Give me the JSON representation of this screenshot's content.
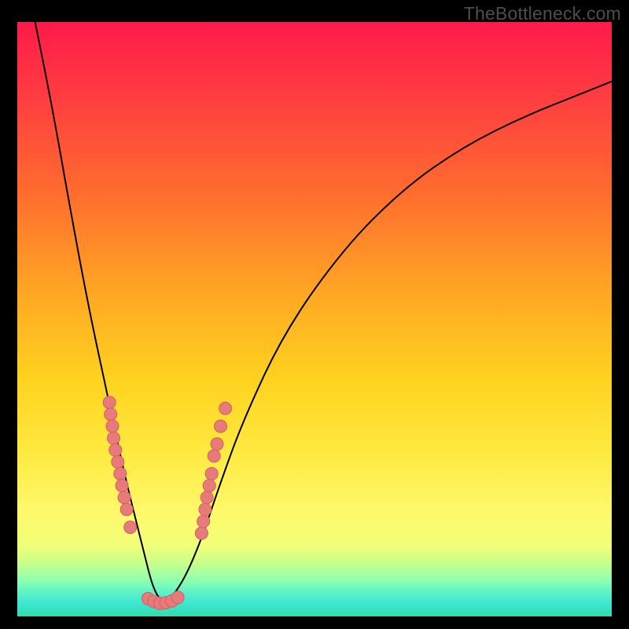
{
  "attribution": "TheBottleneck.com",
  "chart_data": {
    "type": "line",
    "title": "",
    "xlabel": "",
    "ylabel": "",
    "xlim": [
      0,
      100
    ],
    "ylim": [
      0,
      100
    ],
    "curve": {
      "description": "V-shaped bottleneck curve; minimum bottleneck near x≈24",
      "x": [
        3,
        6,
        9,
        12,
        15,
        18,
        21,
        23,
        25,
        28,
        31,
        34,
        38,
        45,
        55,
        65,
        75,
        85,
        95,
        100
      ],
      "y": [
        100,
        85,
        68,
        52,
        38,
        24,
        12,
        4,
        2,
        6,
        13,
        22,
        33,
        48,
        62,
        72,
        79,
        84,
        88,
        90
      ]
    },
    "series": [
      {
        "name": "left-cluster-dots",
        "color": "#e77a7a",
        "x": [
          15.5,
          15.7,
          16.0,
          16.2,
          16.5,
          16.9,
          17.3,
          17.6,
          18.0,
          18.4,
          19.0
        ],
        "y": [
          36,
          34,
          32,
          30,
          28,
          26,
          24,
          22,
          20,
          18,
          15
        ]
      },
      {
        "name": "right-cluster-dots",
        "color": "#e77a7a",
        "x": [
          31.0,
          31.3,
          31.6,
          31.9,
          32.3,
          32.7,
          33.1,
          33.6,
          34.2,
          35.0
        ],
        "y": [
          14,
          16,
          18,
          20,
          22,
          24,
          27,
          29,
          32,
          35
        ]
      },
      {
        "name": "bottom-dots",
        "color": "#e77a7a",
        "x": [
          22.0,
          23.0,
          24.0,
          25.0,
          26.0,
          27.0
        ],
        "y": [
          3.0,
          2.5,
          2.2,
          2.3,
          2.6,
          3.2
        ]
      }
    ]
  }
}
